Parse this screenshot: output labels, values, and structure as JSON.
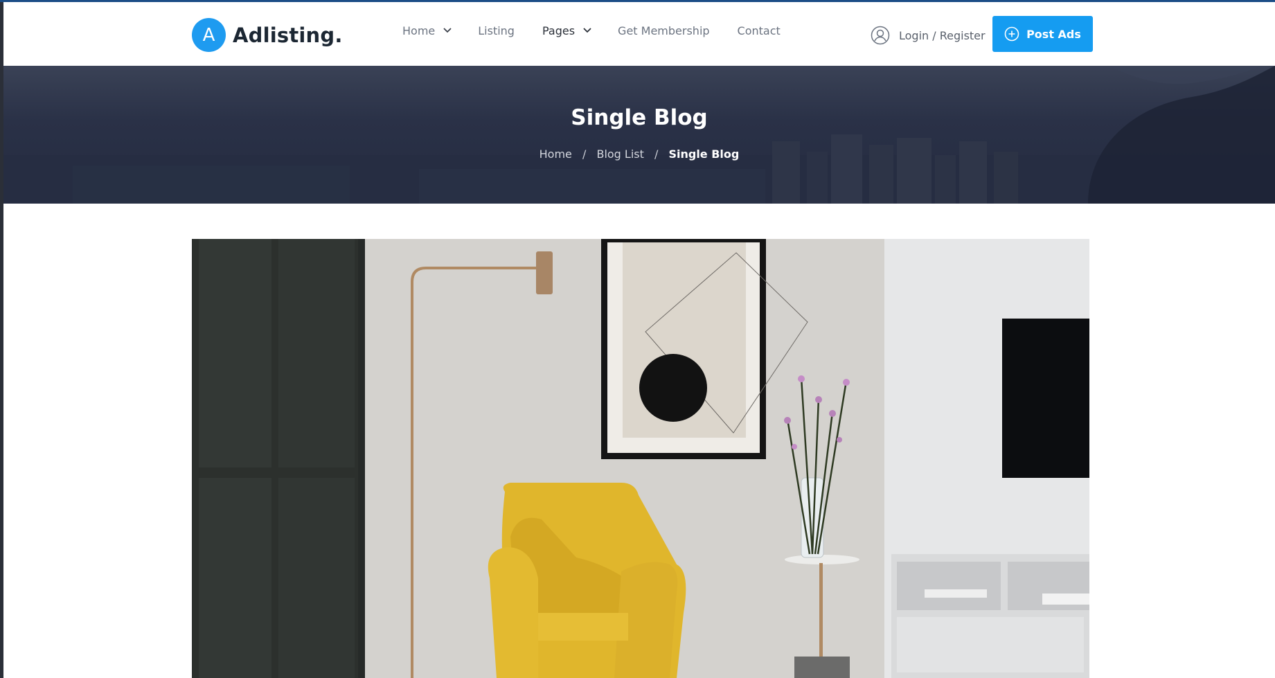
{
  "brand": {
    "logo_letter": "A",
    "name": "Adlisting.",
    "accent": "#1e9bf0"
  },
  "nav": {
    "items": [
      {
        "label": "Home",
        "has_dropdown": true
      },
      {
        "label": "Listing",
        "has_dropdown": false
      },
      {
        "label": "Pages",
        "has_dropdown": true
      },
      {
        "label": "Get Membership",
        "has_dropdown": false
      },
      {
        "label": "Contact",
        "has_dropdown": false
      }
    ]
  },
  "account": {
    "login_label": "Login / Register",
    "icon": "user-circle-icon"
  },
  "post_ads": {
    "label": "Post Ads",
    "icon": "plus-circle-icon",
    "color": "#159cf1"
  },
  "hero": {
    "title": "Single Blog",
    "breadcrumb": [
      "Home",
      "Blog List",
      "Single Blog"
    ],
    "separator": "/"
  },
  "featured_image": {
    "icon": "featured-photo-image"
  }
}
